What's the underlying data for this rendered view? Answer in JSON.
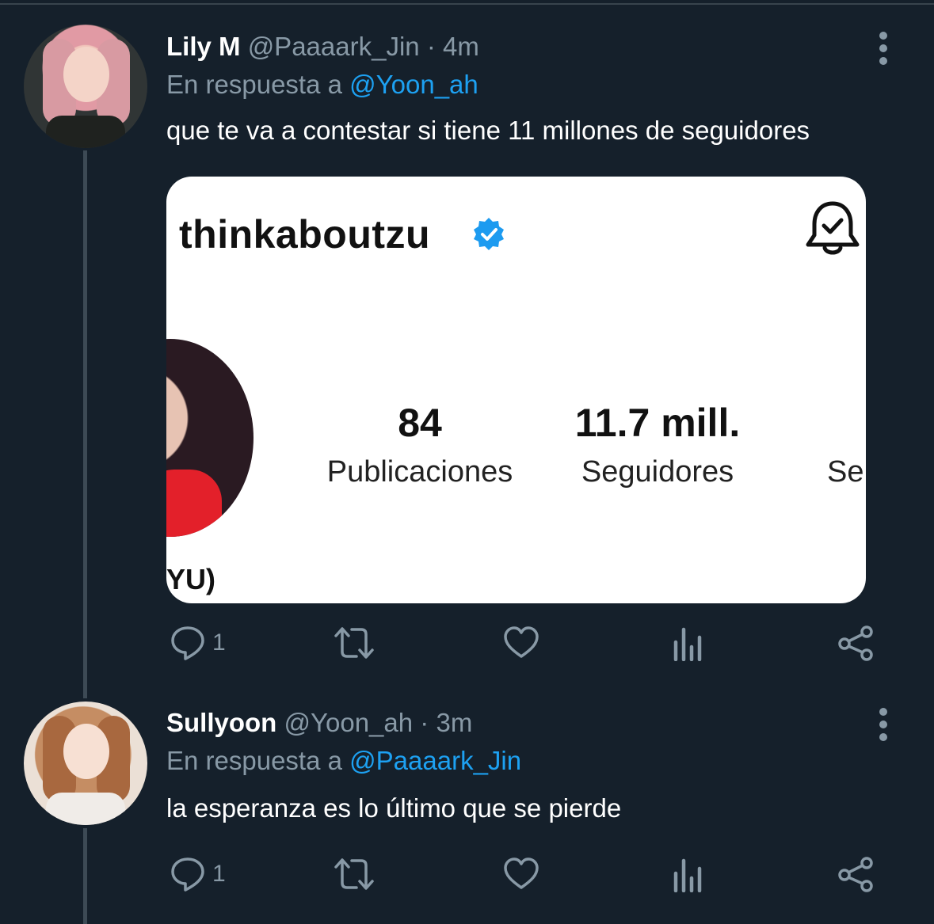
{
  "tweets": [
    {
      "display_name": "Lily M",
      "handle": "@Paaaark_Jin",
      "time": "4m",
      "reply_prefix": "En respuesta a",
      "reply_to": "@Yoon_ah",
      "text": "que te va a contestar si tiene 11 millones de seguidores",
      "reply_count": "1"
    },
    {
      "display_name": "Sullyoon",
      "handle": "@Yoon_ah",
      "time": "3m",
      "reply_prefix": "En respuesta a",
      "reply_to": "@Paaaark_Jin",
      "text": "la esperanza es lo último que se pierde",
      "reply_count": "1"
    }
  ],
  "media": {
    "username": "thinkaboutzu",
    "posts_count": "84",
    "posts_label": "Publicaciones",
    "followers_count": "11.7 mill.",
    "followers_label": "Seguidores",
    "following_label_cut": "Se",
    "name_fragment": "YU)"
  },
  "separator": "·",
  "icons": {
    "reply": "reply-icon",
    "retweet": "retweet-icon",
    "like": "heart-icon",
    "analytics": "analytics-icon",
    "share": "share-icon",
    "more": "more-vertical-icon",
    "verified": "verified-badge-icon",
    "bell": "notification-bell-icon"
  },
  "colors": {
    "background": "#15202b",
    "text_primary": "#ffffff",
    "text_secondary": "#8899a6",
    "link": "#1da1f2",
    "verified": "#1d9bf0"
  }
}
